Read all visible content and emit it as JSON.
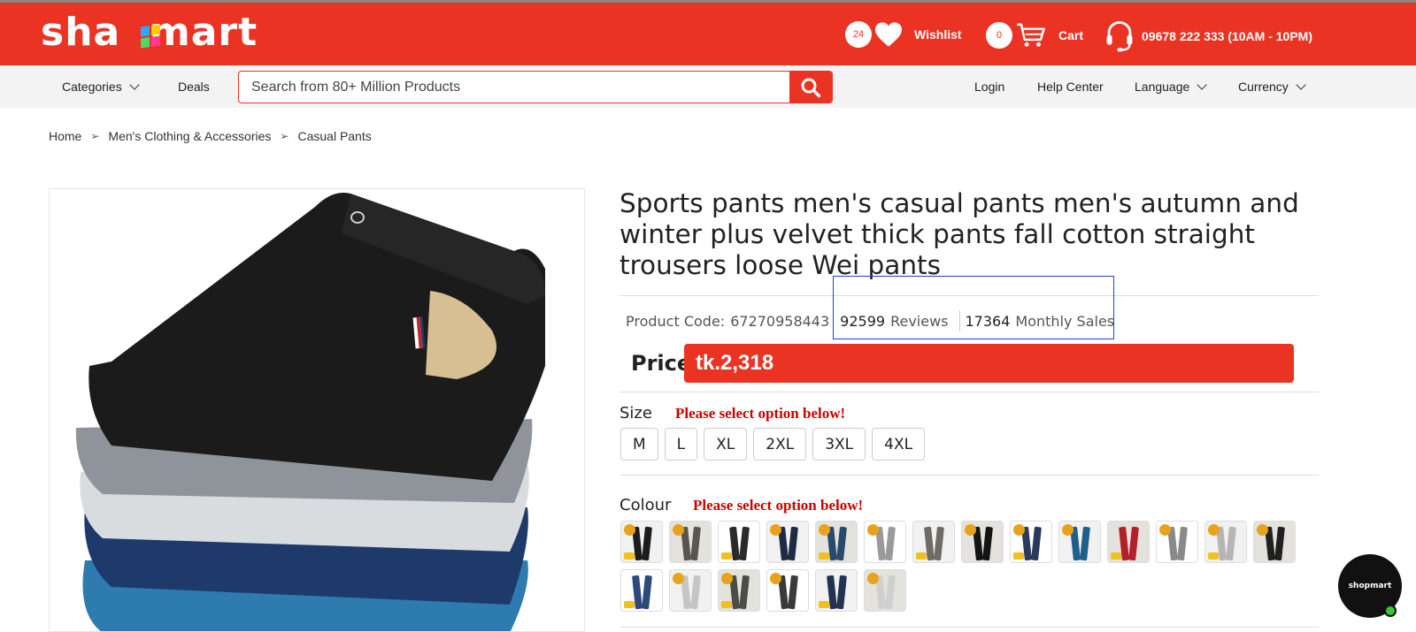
{
  "header": {
    "logo_text": "shopmart",
    "wishlist": {
      "count": "24",
      "label": "Wishlist"
    },
    "cart": {
      "count": "0",
      "label": "Cart"
    },
    "phone": "09678 222 333 (10AM - 10PM)",
    "colors": {
      "primary": "#ea3323"
    }
  },
  "nav": {
    "categories": "Categories",
    "deals": "Deals",
    "login": "Login",
    "help": "Help Center",
    "language": "Language",
    "currency": "Currency"
  },
  "search": {
    "placeholder": "Search from 80+ Million Products"
  },
  "breadcrumb": [
    "Home",
    "Men's Clothing & Accessories",
    "Casual Pants"
  ],
  "product": {
    "title": "Sports pants men's casual pants men's autumn and winter plus velvet thick pants fall cotton straight trousers loose Wei pants",
    "code_label": "Product Code:",
    "code": "67270958443",
    "reviews_count": "92599",
    "reviews_label": "Reviews",
    "sales_count": "17364",
    "sales_label": "Monthly Sales",
    "price_label": "Price",
    "price": "tk.2,318"
  },
  "options": {
    "size_label": "Size",
    "size_warning": "Please select option below!",
    "sizes": [
      "M",
      "L",
      "XL",
      "2XL",
      "3XL",
      "4XL"
    ],
    "colour_label": "Colour",
    "colour_warning": "Please select option below!",
    "swatch_colors": [
      "#1c1c1c",
      "#5a5550",
      "#2a2a2a",
      "#1f2a44",
      "#2a4a6a",
      "#9a9a9a",
      "#6e6a64",
      "#141414",
      "#2b3a5c",
      "#1f5f8c",
      "#b3202a",
      "#8a8a8a",
      "#b5b5b5",
      "#202020",
      "#2c4a7a",
      "#c5c5c5",
      "#4a4f45",
      "#3a3a3a",
      "#233250",
      "#cfcfcf"
    ]
  },
  "chat": {
    "label": "shopmart"
  }
}
